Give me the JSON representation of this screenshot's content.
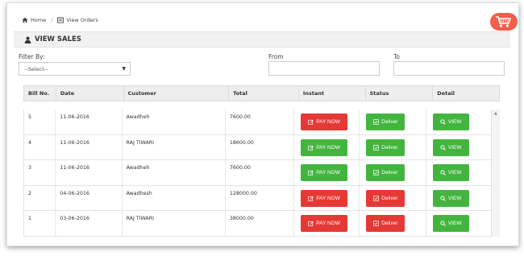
{
  "breadcrumb": {
    "home_label": "Home",
    "orders_label": "View Orders",
    "separator": "/"
  },
  "section": {
    "title": "VIEW SALES"
  },
  "filters": {
    "filter_label": "Filter By:",
    "select_value": "--Select--",
    "from_label": "From",
    "to_label": "To"
  },
  "table": {
    "columns": [
      "Bill No.",
      "Date",
      "Customer",
      "Total",
      "Instant",
      "Status",
      "Detail"
    ],
    "rows": [
      {
        "bill": "5",
        "date": "11-06-2016",
        "customer": "Awadheh",
        "total": "7600.00",
        "instant": "PAY NOW",
        "instant_state": "unpaid",
        "status": "Deliver",
        "status_state": "delivered",
        "detail": "VIEW"
      },
      {
        "bill": "4",
        "date": "11-06-2016",
        "customer": "RAJ TIWARI",
        "total": "18600.00",
        "instant": "PAY NOW",
        "instant_state": "paid",
        "status": "Deliver",
        "status_state": "delivered",
        "detail": "VIEW"
      },
      {
        "bill": "3",
        "date": "11-06-2016",
        "customer": "Awadheh",
        "total": "7600.00",
        "instant": "PAY NOW",
        "instant_state": "paid",
        "status": "Deliver",
        "status_state": "delivered",
        "detail": "VIEW"
      },
      {
        "bill": "2",
        "date": "04-06-2016",
        "customer": "Awadhesh",
        "total": "128000.00",
        "instant": "PAY NOW",
        "instant_state": "unpaid",
        "status": "Deliver",
        "status_state": "pending",
        "detail": "VIEW"
      },
      {
        "bill": "1",
        "date": "03-06-2016",
        "customer": "RAJ TIWARI",
        "total": "38000.00",
        "instant": "PAY NOW",
        "instant_state": "unpaid",
        "status": "Deliver",
        "status_state": "pending",
        "detail": "VIEW"
      }
    ]
  },
  "colors": {
    "red": "#e53935",
    "green": "#43b53f",
    "cart": "#ef5f4b"
  },
  "icons": {
    "home": "home-icon",
    "orders": "list-icon",
    "cart": "shopping-cart-icon",
    "user": "user-icon",
    "pay": "edit-icon",
    "status": "check-square-icon",
    "view": "search-icon"
  }
}
